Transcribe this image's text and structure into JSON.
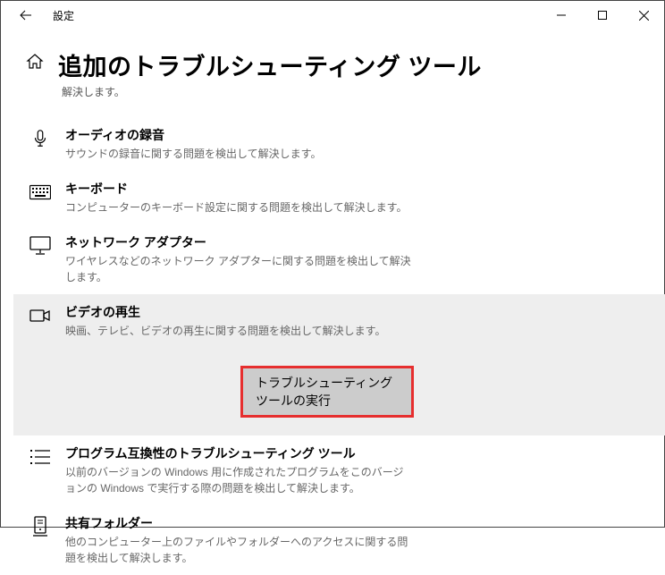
{
  "window": {
    "title": "設定"
  },
  "page": {
    "title": "追加のトラブルシューティング ツール",
    "subtitle": "解決します。"
  },
  "items": [
    {
      "title": "オーディオの録音",
      "desc": "サウンドの録音に関する問題を検出して解決します。"
    },
    {
      "title": "キーボード",
      "desc": "コンピューターのキーボード設定に関する問題を検出して解決します。"
    },
    {
      "title": "ネットワーク アダプター",
      "desc": "ワイヤレスなどのネットワーク アダプターに関する問題を検出して解決します。"
    },
    {
      "title": "ビデオの再生",
      "desc": "映画、テレビ、ビデオの再生に関する問題を検出して解決します。",
      "button": "トラブルシューティング ツールの実行"
    },
    {
      "title": "プログラム互換性のトラブルシューティング ツール",
      "desc": "以前のバージョンの Windows 用に作成されたプログラムをこのバージョンの Windows で実行する際の問題を検出して解決します。"
    },
    {
      "title": "共有フォルダー",
      "desc": "他のコンピューター上のファイルやフォルダーへのアクセスに関する問題を検出して解決します。"
    }
  ]
}
